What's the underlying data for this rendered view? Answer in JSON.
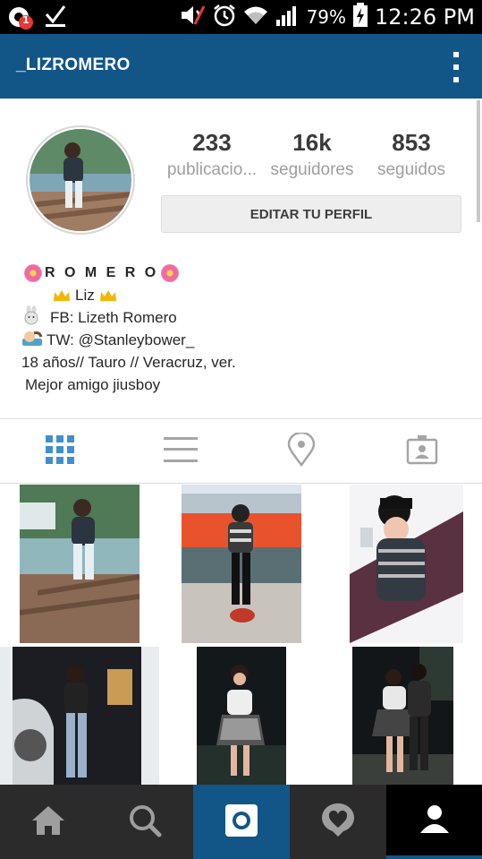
{
  "status_bar": {
    "battery_percent": "79%",
    "time": "12:26 PM",
    "notification_count": "1"
  },
  "app_bar": {
    "username": "_LIZROMERO"
  },
  "profile": {
    "stats": {
      "posts_value": "233",
      "posts_label": "publicacio...",
      "followers_value": "16k",
      "followers_label": "seguidores",
      "following_value": "853",
      "following_label": "seguidos"
    },
    "edit_button_label": "EDITAR TU PERFIL",
    "bio": {
      "name": "R O M E R O",
      "line2": "Liz",
      "line3": "FB: Lizeth Romero",
      "line4": "TW: @Stanleybower_",
      "line5": "18 años// Tauro // Veracruz, ver.",
      "line6": "Mejor amigo jiusboy"
    }
  },
  "view_tabs": [
    "grid-view",
    "list-view",
    "location-view",
    "tagged-view"
  ],
  "active_view_tab": "grid-view",
  "bottom_nav": [
    "home",
    "search",
    "camera",
    "activity",
    "profile"
  ],
  "active_bottom_nav": "profile",
  "colors": {
    "brand_blue": "#125688",
    "active_tab_blue": "#3f8fd0",
    "bottom_nav_bg": "#2b2b2b",
    "camera_tab_bg": "#125688"
  }
}
